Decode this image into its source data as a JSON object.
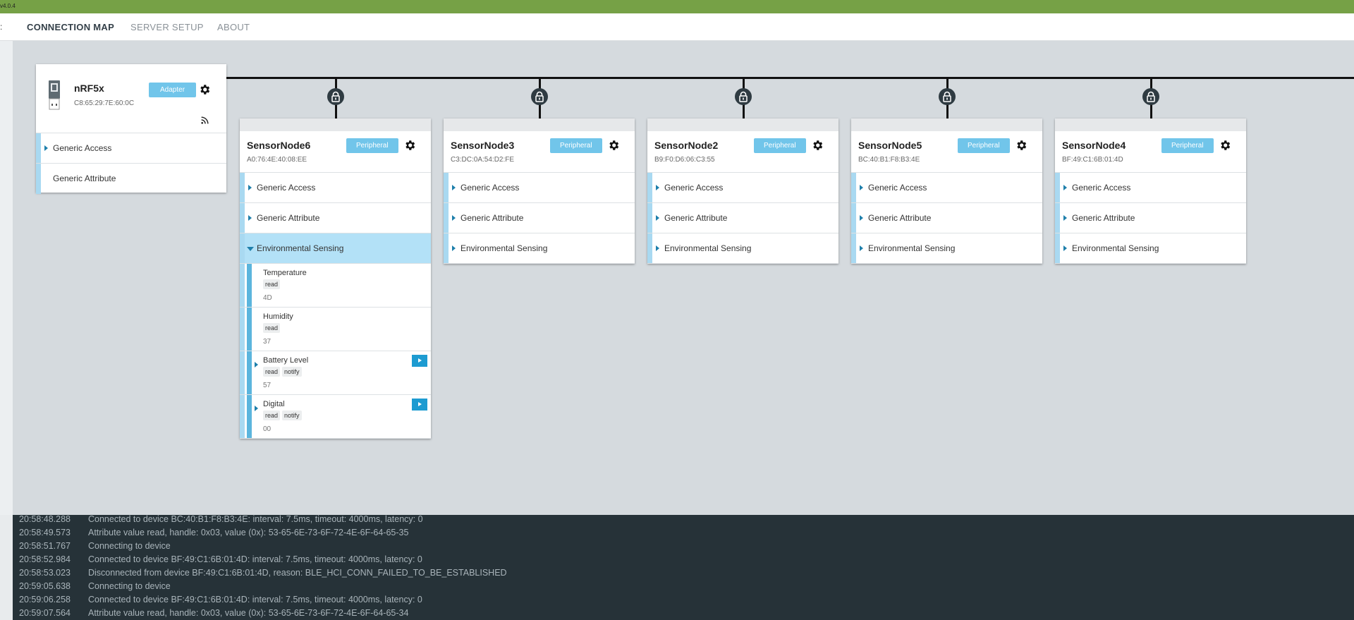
{
  "app": {
    "version": "v4.0.4"
  },
  "nav": {
    "handle": ":",
    "tabs": [
      {
        "label": "CONNECTION MAP",
        "active": true
      },
      {
        "label": "SERVER SETUP",
        "active": false
      },
      {
        "label": "ABOUT",
        "active": false
      }
    ]
  },
  "colors": {
    "accent_bar": "#76a146",
    "badge": "#71c5ea",
    "log_bg": "#263238",
    "service_stripe": "#a9d9f1"
  },
  "adapter": {
    "icon": "usb-dongle-icon",
    "name": "nRF5x",
    "address": "C8:65:29:7E:60:0C",
    "badge": "Adapter",
    "advertise_icon": "rss-icon",
    "services": [
      "Generic Access",
      "Generic Attribute"
    ]
  },
  "devices": [
    {
      "name": "SensorNode6",
      "address": "A0:76:4E:40:08:EE",
      "badge": "Peripheral",
      "services": [
        "Generic Access",
        "Generic Attribute",
        "Environmental Sensing"
      ],
      "expanded_service": "Environmental Sensing",
      "characteristics": [
        {
          "name": "Temperature",
          "props": [
            "read"
          ],
          "value": "4D",
          "notify": false
        },
        {
          "name": "Humidity",
          "props": [
            "read"
          ],
          "value": "37",
          "notify": false
        },
        {
          "name": "Battery Level",
          "props": [
            "read",
            "notify"
          ],
          "value": "57",
          "notify": true
        },
        {
          "name": "Digital",
          "props": [
            "read",
            "notify"
          ],
          "value": "00",
          "notify": true
        }
      ]
    },
    {
      "name": "SensorNode3",
      "address": "C3:DC:0A:54:D2:FE",
      "badge": "Peripheral",
      "services": [
        "Generic Access",
        "Generic Attribute",
        "Environmental Sensing"
      ]
    },
    {
      "name": "SensorNode2",
      "address": "B9:F0:D6:06:C3:55",
      "badge": "Peripheral",
      "services": [
        "Generic Access",
        "Generic Attribute",
        "Environmental Sensing"
      ]
    },
    {
      "name": "SensorNode5",
      "address": "BC:40:B1:F8:B3:4E",
      "badge": "Peripheral",
      "services": [
        "Generic Access",
        "Generic Attribute",
        "Environmental Sensing"
      ]
    },
    {
      "name": "SensorNode4",
      "address": "BF:49:C1:6B:01:4D",
      "badge": "Peripheral",
      "services": [
        "Generic Access",
        "Generic Attribute",
        "Environmental Sensing"
      ]
    }
  ],
  "log": [
    {
      "time": "20:58:48.288",
      "msg": "Connected to device BC:40:B1:F8:B3:4E: interval: 7.5ms, timeout: 4000ms, latency: 0"
    },
    {
      "time": "20:58:49.573",
      "msg": "Attribute value read, handle: 0x03, value (0x): 53-65-6E-73-6F-72-4E-6F-64-65-35"
    },
    {
      "time": "20:58:51.767",
      "msg": "Connecting to device"
    },
    {
      "time": "20:58:52.984",
      "msg": "Connected to device BF:49:C1:6B:01:4D: interval: 7.5ms, timeout: 4000ms, latency: 0"
    },
    {
      "time": "20:58:53.023",
      "msg": "Disconnected from device BF:49:C1:6B:01:4D, reason: BLE_HCI_CONN_FAILED_TO_BE_ESTABLISHED"
    },
    {
      "time": "20:59:05.638",
      "msg": "Connecting to device"
    },
    {
      "time": "20:59:06.258",
      "msg": "Connected to device BF:49:C1:6B:01:4D: interval: 7.5ms, timeout: 4000ms, latency: 0"
    },
    {
      "time": "20:59:07.564",
      "msg": "Attribute value read, handle: 0x03, value (0x): 53-65-6E-73-6F-72-4E-6F-64-65-34"
    }
  ]
}
